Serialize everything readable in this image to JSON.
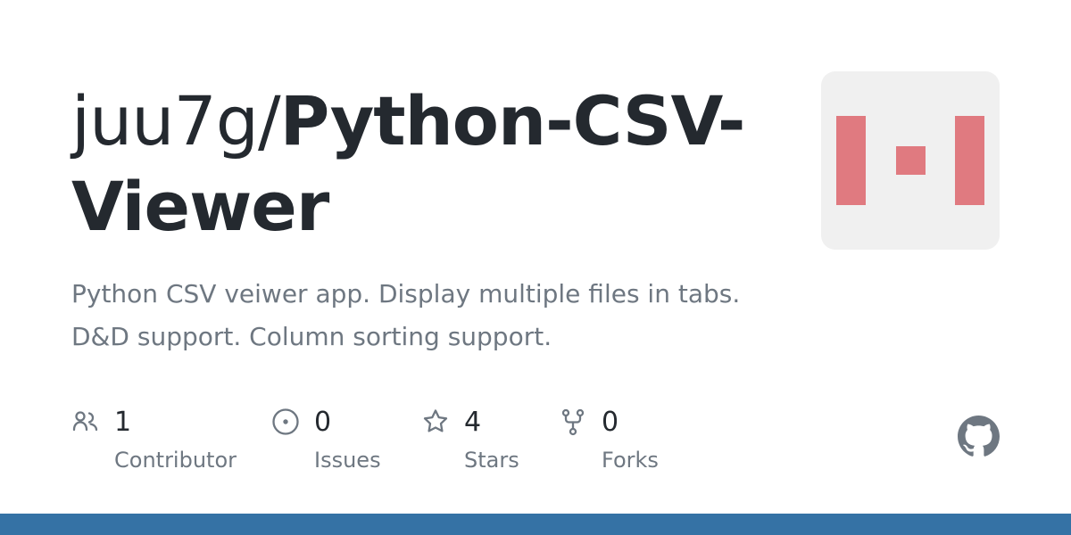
{
  "repo": {
    "owner": "juu7g/",
    "name": "Python-CSV-Viewer",
    "description": "Python CSV veiwer app. Display multiple files in tabs. D&D support. Column sorting support."
  },
  "stats": {
    "contributors": {
      "count": "1",
      "label": "Contributor",
      "icon": "people-icon"
    },
    "issues": {
      "count": "0",
      "label": "Issues",
      "icon": "issue-opened-icon"
    },
    "stars": {
      "count": "4",
      "label": "Stars",
      "icon": "star-icon"
    },
    "forks": {
      "count": "0",
      "label": "Forks",
      "icon": "repo-forked-icon"
    }
  },
  "colors": {
    "title_text": "#24292f",
    "muted_text": "#6e7781",
    "avatar_background": "#f0f0f0",
    "avatar_pattern": "#e07a80",
    "language_bar": "#3572a5",
    "github_logo": "#6e7781"
  },
  "icons": {
    "brand": "github-mark-icon"
  }
}
